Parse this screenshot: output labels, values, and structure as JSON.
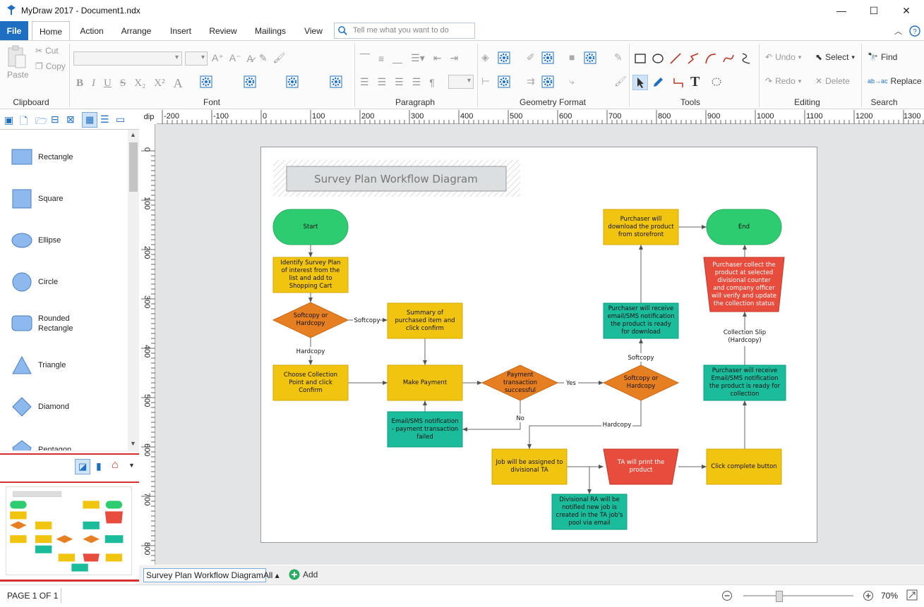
{
  "window": {
    "title": "MyDraw 2017 - Document1.ndx",
    "minimize": "—",
    "maximize": "☐",
    "close": "✕"
  },
  "tabs": {
    "file": "File",
    "home": "Home",
    "action": "Action",
    "arrange": "Arrange",
    "insert": "Insert",
    "review": "Review",
    "mailings": "Mailings",
    "view": "View",
    "search_placeholder": "Tell me what you want to do"
  },
  "ribbon": {
    "clipboard": {
      "label": "Clipboard",
      "paste": "Paste",
      "cut": "Cut",
      "copy": "Copy"
    },
    "font": {
      "label": "Font"
    },
    "paragraph": {
      "label": "Paragraph"
    },
    "geometry": {
      "label": "Geometry Format"
    },
    "tools": {
      "label": "Tools"
    },
    "editing": {
      "label": "Editing",
      "undo": "Undo",
      "redo": "Redo",
      "select": "Select",
      "delete": "Delete"
    },
    "search": {
      "label": "Search",
      "find": "Find",
      "replace": "Replace"
    }
  },
  "shapes": [
    {
      "label": "Rectangle",
      "icon": "rectangle-shape"
    },
    {
      "label": "Square",
      "icon": "square-shape"
    },
    {
      "label": "Ellipse",
      "icon": "ellipse-shape"
    },
    {
      "label": "Circle",
      "icon": "circle-shape"
    },
    {
      "label": "Rounded Rectangle",
      "icon": "rounded-rectangle-shape"
    },
    {
      "label": "Triangle",
      "icon": "triangle-shape"
    },
    {
      "label": "Diamond",
      "icon": "diamond-shape"
    },
    {
      "label": "Pentagon",
      "icon": "pentagon-shape"
    }
  ],
  "ruler": {
    "unit": "dip",
    "top_ticks": [
      "-200",
      "-100",
      "0",
      "100",
      "200",
      "300",
      "400",
      "500",
      "600",
      "700",
      "800",
      "900",
      "1000",
      "1100",
      "1200",
      "1300"
    ],
    "left_ticks": [
      "0",
      "100",
      "200",
      "300",
      "400",
      "500",
      "600",
      "700",
      "800"
    ]
  },
  "diagram": {
    "title": "Survey Plan Workflow Diagram",
    "nodes": {
      "start": "Start",
      "identify": "Identify Survey Plan of interest from the list and add to Shopping Cart",
      "softhard1": "Softcopy or Hardcopy",
      "summary": "Summary of purchased item and click confirm",
      "choose": "Choose Collection Point and click Confirm",
      "payment": "Make Payment",
      "paysuccess": "Payment transaction successful",
      "emailfail": "Email/SMS notification - payment transaction failed",
      "softhard2": "Softcopy or Hardcopy",
      "notify_ready": "Purchaser will receive email/SMS notification the product is ready for download",
      "download": "Purchaser will download the product from storefront",
      "end": "End",
      "collect": "Purchaser collect the product at selected divisional counter and company officer will verify and update the collection status",
      "notify_collect": "Purchaser will receive Email/SMS notification the product is ready for collection",
      "assign": "Job will be assigned to divisional TA",
      "print": "TA will print the product",
      "click_complete": "Click complete button",
      "ra_notified": "Divisional RA will be notified new job is created in the TA job's pool via email"
    },
    "edges": {
      "softcopy1": "Softcopy",
      "hardcopy1": "Hardcopy",
      "yes": "Yes",
      "no": "No",
      "softcopy2": "Softcopy",
      "hardcopy2": "Hardcopy",
      "collection_slip": "Collection Slip (Hardcopy)"
    },
    "colors": {
      "green": "#2ecc71",
      "yellow": "#f1c40f",
      "orange": "#e67e22",
      "teal": "#1abc9c",
      "red": "#e74c3c"
    }
  },
  "pagetabs": {
    "current": "Survey Plan Workflow Diagram",
    "all": "All ▴",
    "add": "Add"
  },
  "status": {
    "page": "PAGE 1 OF 1",
    "zoom": "70%",
    "zoom_level": 0.7
  }
}
